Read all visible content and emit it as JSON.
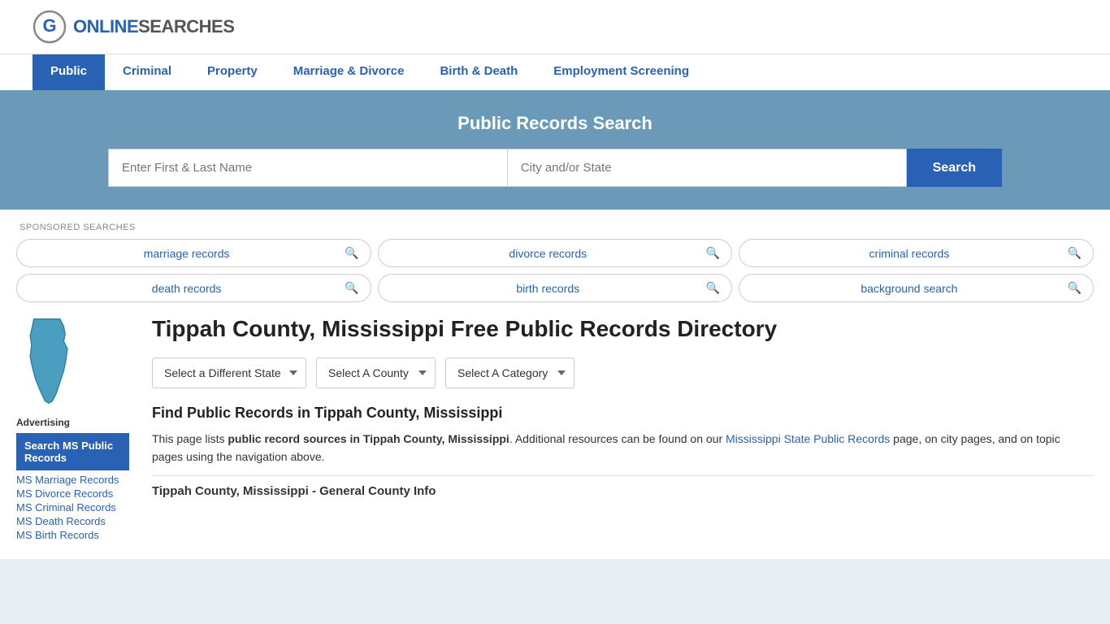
{
  "header": {
    "logo_text_normal": "ONLINE",
    "logo_text_colored": "SEARCHES"
  },
  "nav": {
    "items": [
      {
        "label": "Public",
        "active": true
      },
      {
        "label": "Criminal",
        "active": false
      },
      {
        "label": "Property",
        "active": false
      },
      {
        "label": "Marriage & Divorce",
        "active": false
      },
      {
        "label": "Birth & Death",
        "active": false
      },
      {
        "label": "Employment Screening",
        "active": false
      }
    ]
  },
  "hero": {
    "title": "Public Records Search",
    "name_placeholder": "Enter First & Last Name",
    "location_placeholder": "City and/or State",
    "search_button": "Search"
  },
  "sponsored": {
    "label": "SPONSORED SEARCHES",
    "pills": [
      {
        "text": "marriage records"
      },
      {
        "text": "divorce records"
      },
      {
        "text": "criminal records"
      },
      {
        "text": "death records"
      },
      {
        "text": "birth records"
      },
      {
        "text": "background search"
      }
    ]
  },
  "sidebar": {
    "advertising_label": "Advertising",
    "ad_link_label": "Search MS Public Records",
    "links": [
      {
        "label": "MS Marriage Records"
      },
      {
        "label": "MS Divorce Records"
      },
      {
        "label": "MS Criminal Records"
      },
      {
        "label": "MS Death Records"
      },
      {
        "label": "MS Birth Records"
      }
    ]
  },
  "main": {
    "page_title": "Tippah County, Mississippi Free Public Records Directory",
    "dropdowns": {
      "state": "Select a Different State",
      "county": "Select A County",
      "category": "Select A Category"
    },
    "find_title": "Find Public Records in Tippah County, Mississippi",
    "find_text_before": "This page lists ",
    "find_bold": "public record sources in Tippah County, Mississippi",
    "find_text_after": ". Additional resources can be found on our ",
    "find_link": "Mississippi State Public Records",
    "find_text_end": " page, on city pages, and on topic pages using the navigation above.",
    "section_title": "Tippah County, Mississippi - General County Info"
  }
}
